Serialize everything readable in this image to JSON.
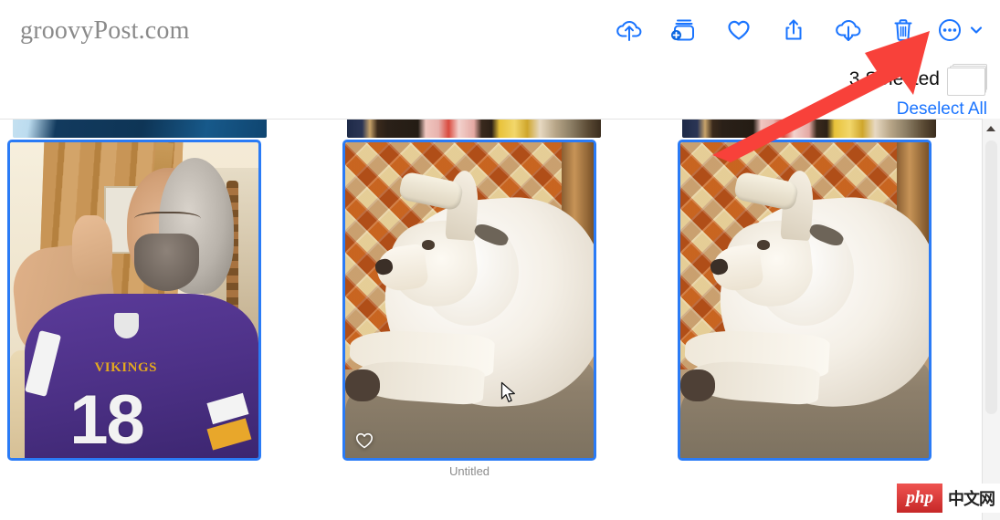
{
  "watermark": {
    "text": "groovyPost.com"
  },
  "toolbar": {
    "items": [
      {
        "name": "upload-to-icloud-icon",
        "label": "Upload"
      },
      {
        "name": "add-to-album-icon",
        "label": "Add To Album"
      },
      {
        "name": "favorite-heart-icon",
        "label": "Favorite"
      },
      {
        "name": "share-icon",
        "label": "Share"
      },
      {
        "name": "download-icon",
        "label": "Download"
      },
      {
        "name": "trash-icon",
        "label": "Delete"
      },
      {
        "name": "more-options-icon",
        "label": "More"
      }
    ],
    "accent_color": "#1a74ff"
  },
  "selection": {
    "count_label": "3 Selected",
    "deselect_label": "Deselect All",
    "deselect_color": "#1a74ff"
  },
  "grid": {
    "photos": [
      {
        "caption": "",
        "alt": "man-in-vikings-jersey-selfie",
        "selected": true,
        "favorite": false,
        "jersey_number": "18",
        "jersey_wordmark": "VIKINGS"
      },
      {
        "caption": "Untitled",
        "alt": "white-dog-on-tile-floor",
        "selected": true,
        "favorite": true
      },
      {
        "caption": "",
        "alt": "white-dog-on-tile-floor",
        "selected": true,
        "favorite": false
      }
    ]
  },
  "annotation": {
    "arrow_color": "#f8413a",
    "points_to": "trash-icon"
  },
  "scrollbar": {
    "position": "right"
  },
  "badge": {
    "php_label": "php",
    "word_label": "中文网"
  }
}
